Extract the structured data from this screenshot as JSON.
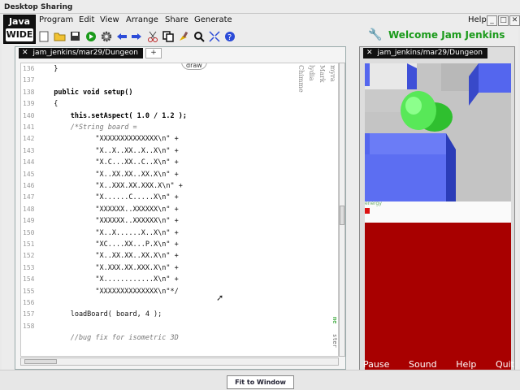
{
  "window": {
    "title": "Desktop Sharing"
  },
  "logo": {
    "line1": "Java",
    "line2": "WIDE"
  },
  "menu": {
    "items": [
      "Program",
      "Edit",
      "View",
      "Arrange",
      "Share",
      "Generate"
    ],
    "help": "Help",
    "window_buttons": [
      "_",
      "□",
      "✕"
    ]
  },
  "toolbar": {
    "icons": [
      "new-file-icon",
      "open-folder-icon",
      "save-icon",
      "run-icon",
      "gear-icon",
      "undo-icon",
      "redo-icon",
      "cut-icon",
      "copy-icon",
      "paint-icon",
      "search-icon",
      "resize-icon",
      "help-icon"
    ]
  },
  "user": {
    "welcome": "Welcome Jam Jenkins"
  },
  "editor": {
    "tab": "jam_jenkins/mar29/Dungeon",
    "tab_add": "+",
    "draw_label": "draw",
    "side_names": [
      "Chimme",
      "lydia",
      "Mark",
      "myra"
    ],
    "side_badge_1": "me",
    "side_badge_2": "ster",
    "lines": [
      {
        "n": "136",
        "text": "  }"
      },
      {
        "n": "137",
        "text": ""
      },
      {
        "n": "138",
        "text": "  public void setup()"
      },
      {
        "n": "139",
        "text": "  {"
      },
      {
        "n": "140",
        "text": "      this.setAspect( 1.0 / 1.2 );"
      },
      {
        "n": "141",
        "text": "      /*String board ="
      },
      {
        "n": "142",
        "text": "            \"XXXXXXXXXXXXXX\\n\" +"
      },
      {
        "n": "143",
        "text": "            \"X..X..XX..X..X\\n\" +"
      },
      {
        "n": "144",
        "text": "            \"X.C...XX..C..X\\n\" +"
      },
      {
        "n": "145",
        "text": "            \"X..XX.XX..XX.X\\n\" +"
      },
      {
        "n": "146",
        "text": "            \"X..XXX.XX.XXX.X\\n\" +"
      },
      {
        "n": "147",
        "text": "            \"X......C.....X\\n\" +"
      },
      {
        "n": "148",
        "text": "            \"XXXXXX..XXXXXX\\n\" +"
      },
      {
        "n": "149",
        "text": "            \"XXXXXX..XXXXXX\\n\" +"
      },
      {
        "n": "150",
        "text": "            \"X..X......X..X\\n\" +"
      },
      {
        "n": "151",
        "text": "            \"XC....XX...P.X\\n\" +"
      },
      {
        "n": "152",
        "text": "            \"X..XX.XX..XX.X\\n\" +"
      },
      {
        "n": "153",
        "text": "            \"X.XXX.XX.XXX.X\\n\" +"
      },
      {
        "n": "154",
        "text": "            \"X............X\\n\" +"
      },
      {
        "n": "155",
        "text": "            \"XXXXXXXXXXXXXX\\n\"*/"
      },
      {
        "n": "156",
        "text": ""
      },
      {
        "n": "157",
        "text": "      loadBoard( board, 4 );"
      },
      {
        "n": "158",
        "text": ""
      },
      {
        "n": "",
        "text": "      //bug fix for isometric 3D"
      }
    ]
  },
  "game": {
    "tab": "jam_jenkins/mar29/Dungeon",
    "energy_label": "energy",
    "controls": [
      "Pause",
      "Sound",
      "Help",
      "Quit"
    ],
    "colors": {
      "floor": "#a80000",
      "wall": "#5a6cf0",
      "player": "#28d028"
    }
  },
  "bottom": {
    "fit_button": "Fit to Window"
  }
}
